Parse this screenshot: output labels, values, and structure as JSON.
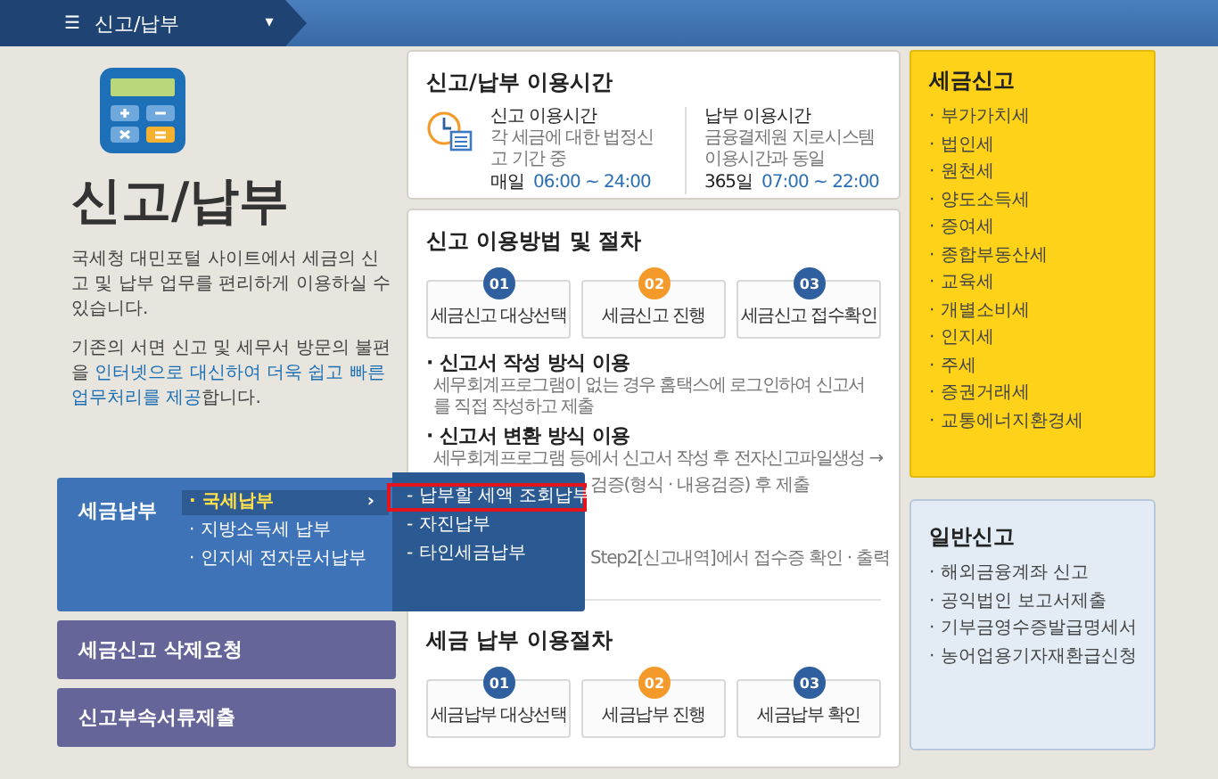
{
  "topbar": {
    "menu_icon": "☰",
    "title": "신고/납부",
    "dropdown": "▾"
  },
  "intro": {
    "title": "신고/납부",
    "description": "국세청 대민포털 사이트에서 세금의 신고 및 납부 업무를 편리하게 이용하실 수 있습니다.",
    "note": "기존의 서면 신고 및 세무서 방문의 불편을 **인터넷으로 대신하여 더욱 쉽고 빠른 업무처리를 제공**합니다."
  },
  "side_menu": [
    {
      "label": "세금납부",
      "kind": "expanded",
      "submenu": [
        {
          "label": "· 국세납부",
          "arrow": "›",
          "selected": true
        },
        {
          "label": "· 지방소득세 납부",
          "selected": false
        },
        {
          "label": "· 인지세 전자문서납부",
          "selected": false
        }
      ],
      "flyout": [
        {
          "label": "- 납부할 세액 조회납부",
          "selected": true
        },
        {
          "label": "- 자진납부",
          "selected": false
        },
        {
          "label": "- 타인세금납부",
          "selected": false
        }
      ]
    },
    {
      "label": "세금신고 삭제요청",
      "kind": "plain"
    },
    {
      "label": "신고부속서류제출",
      "kind": "plain"
    }
  ],
  "hours": {
    "title": "신고/납부 이용시간",
    "columns": [
      {
        "title": "신고 이용시간",
        "text": "각 세금에 대한 법정신고 기간 중",
        "day": "매일",
        "time": "06:00 ~ 24:00"
      },
      {
        "title": "납부 이용시간",
        "text": "금융결제원 지로시스템 이용시간과 동일",
        "day": "365일",
        "time": "07:00 ~ 22:00"
      }
    ]
  },
  "procedure": {
    "title": "신고 이용방법 및 절차",
    "steps": [
      {
        "number": "01",
        "label": "세금신고 대상선택",
        "color": "#2f5f9e"
      },
      {
        "number": "02",
        "label": "세금신고 진행",
        "color": "#f39a2b"
      },
      {
        "number": "03",
        "label": "세금신고 접수확인",
        "color": "#2f5f9e"
      }
    ],
    "sections": [
      {
        "heading": "· 신고서 작성 방식 이용",
        "lines": [
          "세무회계프로그램이 없는 경우 홈택스에 로그인하여 신고서를 직접 작성하고 제출"
        ]
      },
      {
        "heading": "· 신고서 변환 방식 이용",
        "lines": [
          "세무회계프로그램 등에서 신고서 작성 후 전자신고파일생성 →"
        ]
      }
    ],
    "covered_fragments": [
      "검증(형식 · 내용검증) 후 제출",
      "Step2[신고내역]에서 접수증 확인 · 출력"
    ],
    "payment_title": "세금 납부 이용절차",
    "payment_steps": [
      {
        "number": "01",
        "label": "세금납부 대상선택",
        "color": "#2f5f9e"
      },
      {
        "number": "02",
        "label": "세금납부 진행",
        "color": "#f39a2b"
      },
      {
        "number": "03",
        "label": "세금납부 확인",
        "color": "#2f5f9e"
      }
    ]
  },
  "tax_report": {
    "title": "세금신고",
    "items": [
      "· 부가가치세",
      "· 법인세",
      "· 원천세",
      "· 양도소득세",
      "· 증여세",
      "· 종합부동산세",
      "· 교육세",
      "· 개별소비세",
      "· 인지세",
      "· 주세",
      "· 증권거래세",
      "· 교통에너지환경세"
    ]
  },
  "general_report": {
    "title": "일반신고",
    "items": [
      "· 해외금융계좌 신고",
      "· 공익법인 보고서제출",
      "· 기부금영수증발급명세서",
      "· 농어업용기자재환급신청"
    ]
  }
}
